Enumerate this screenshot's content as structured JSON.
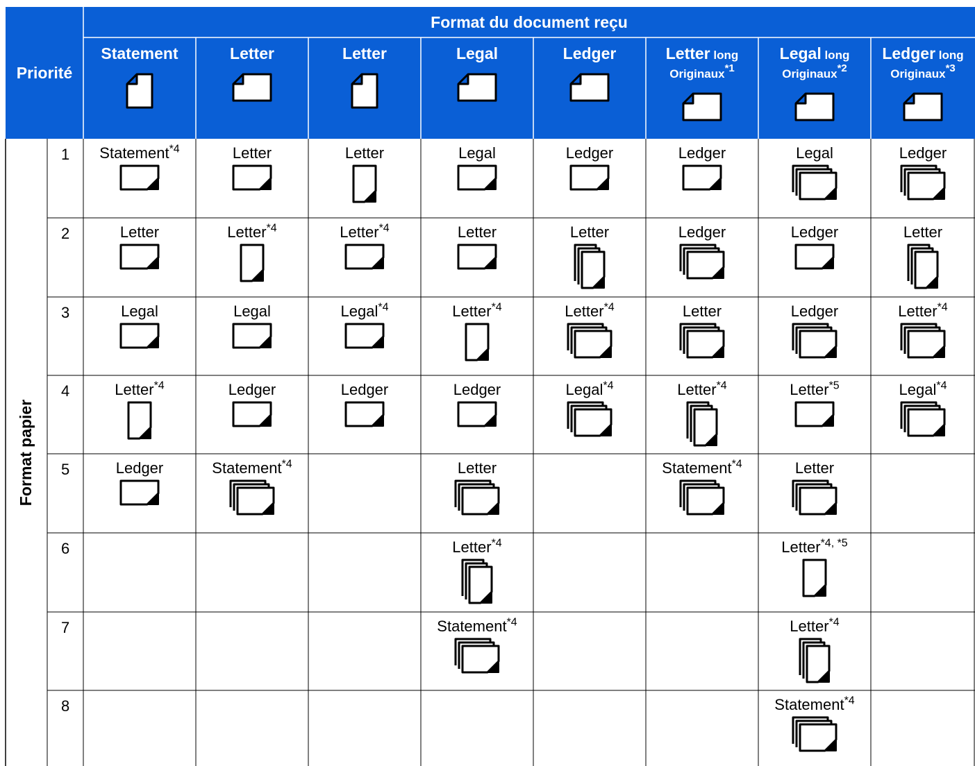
{
  "header": {
    "title": "Format du document reçu",
    "priority_label": "Priorité",
    "side_label": "Format papier"
  },
  "columns": [
    {
      "name": "Statement",
      "suffix": "",
      "line2": "",
      "note": "",
      "icon": "portrait-sheet-folded-top-left"
    },
    {
      "name": "Letter",
      "suffix": "",
      "line2": "",
      "note": "",
      "icon": "landscape-sheet-folded-top-left"
    },
    {
      "name": "Letter",
      "suffix": "",
      "line2": "",
      "note": "",
      "icon": "portrait-sheet-folded-top-left"
    },
    {
      "name": "Legal",
      "suffix": "",
      "line2": "",
      "note": "",
      "icon": "landscape-sheet-folded-top-left"
    },
    {
      "name": "Ledger",
      "suffix": "",
      "line2": "",
      "note": "",
      "icon": "landscape-sheet-folded-top-left"
    },
    {
      "name": "Letter",
      "suffix": " long",
      "line2": "Originaux",
      "note": "*1",
      "icon": "landscape-sheet-folded-top-left"
    },
    {
      "name": "Legal",
      "suffix": " long",
      "line2": "Originaux",
      "note": "*2",
      "icon": "landscape-sheet-folded-top-left"
    },
    {
      "name": "Ledger",
      "suffix": " long",
      "line2": "Originaux",
      "note": "*3",
      "icon": "landscape-sheet-folded-top-left"
    }
  ],
  "rows": [
    {
      "num": "1",
      "cells": [
        {
          "label": "Statement",
          "note": "*4",
          "icon": "landscape"
        },
        {
          "label": "Letter",
          "note": "",
          "icon": "landscape"
        },
        {
          "label": "Letter",
          "note": "",
          "icon": "portrait"
        },
        {
          "label": "Legal",
          "note": "",
          "icon": "landscape"
        },
        {
          "label": "Ledger",
          "note": "",
          "icon": "landscape"
        },
        {
          "label": "Ledger",
          "note": "",
          "icon": "landscape"
        },
        {
          "label": "Legal",
          "note": "",
          "icon": "landscape-multi"
        },
        {
          "label": "Ledger",
          "note": "",
          "icon": "landscape-multi"
        }
      ]
    },
    {
      "num": "2",
      "cells": [
        {
          "label": "Letter",
          "note": "",
          "icon": "landscape"
        },
        {
          "label": "Letter",
          "note": "*4",
          "icon": "portrait"
        },
        {
          "label": "Letter",
          "note": "*4",
          "icon": "landscape"
        },
        {
          "label": "Letter",
          "note": "",
          "icon": "landscape"
        },
        {
          "label": "Letter",
          "note": "",
          "icon": "portrait-multi"
        },
        {
          "label": "Ledger",
          "note": "",
          "icon": "landscape-multi"
        },
        {
          "label": "Ledger",
          "note": "",
          "icon": "landscape"
        },
        {
          "label": "Letter",
          "note": "",
          "icon": "portrait-multi"
        }
      ]
    },
    {
      "num": "3",
      "cells": [
        {
          "label": "Legal",
          "note": "",
          "icon": "landscape"
        },
        {
          "label": "Legal",
          "note": "",
          "icon": "landscape"
        },
        {
          "label": "Legal",
          "note": "*4",
          "icon": "landscape"
        },
        {
          "label": "Letter",
          "note": "*4",
          "icon": "portrait"
        },
        {
          "label": "Letter",
          "note": "*4",
          "icon": "landscape-multi"
        },
        {
          "label": "Letter",
          "note": "",
          "icon": "landscape-multi"
        },
        {
          "label": "Ledger",
          "note": "",
          "icon": "landscape-multi"
        },
        {
          "label": "Letter",
          "note": "*4",
          "icon": "landscape-multi"
        }
      ]
    },
    {
      "num": "4",
      "cells": [
        {
          "label": "Letter",
          "note": "*4",
          "icon": "portrait"
        },
        {
          "label": "Ledger",
          "note": "",
          "icon": "landscape"
        },
        {
          "label": "Ledger",
          "note": "",
          "icon": "landscape"
        },
        {
          "label": "Ledger",
          "note": "",
          "icon": "landscape"
        },
        {
          "label": "Legal",
          "note": "*4",
          "icon": "landscape-multi"
        },
        {
          "label": "Letter",
          "note": "*4",
          "icon": "portrait-multi"
        },
        {
          "label": "Letter",
          "note": "*5",
          "icon": "landscape"
        },
        {
          "label": "Legal",
          "note": "*4",
          "icon": "landscape-multi"
        }
      ]
    },
    {
      "num": "5",
      "cells": [
        {
          "label": "Ledger",
          "note": "",
          "icon": "landscape"
        },
        {
          "label": "Statement",
          "note": "*4",
          "icon": "landscape-multi"
        },
        {
          "label": "",
          "note": "",
          "icon": ""
        },
        {
          "label": "Letter",
          "note": "",
          "icon": "landscape-multi"
        },
        {
          "label": "",
          "note": "",
          "icon": ""
        },
        {
          "label": "Statement",
          "note": "*4",
          "icon": "landscape-multi"
        },
        {
          "label": "Letter",
          "note": "",
          "icon": "landscape-multi"
        },
        {
          "label": "",
          "note": "",
          "icon": ""
        }
      ]
    },
    {
      "num": "6",
      "cells": [
        {
          "label": "",
          "note": "",
          "icon": ""
        },
        {
          "label": "",
          "note": "",
          "icon": ""
        },
        {
          "label": "",
          "note": "",
          "icon": ""
        },
        {
          "label": "Letter",
          "note": "*4",
          "icon": "portrait-multi"
        },
        {
          "label": "",
          "note": "",
          "icon": ""
        },
        {
          "label": "",
          "note": "",
          "icon": ""
        },
        {
          "label": "Letter",
          "note": "*4, *5",
          "icon": "portrait"
        },
        {
          "label": "",
          "note": "",
          "icon": ""
        }
      ]
    },
    {
      "num": "7",
      "cells": [
        {
          "label": "",
          "note": "",
          "icon": ""
        },
        {
          "label": "",
          "note": "",
          "icon": ""
        },
        {
          "label": "",
          "note": "",
          "icon": ""
        },
        {
          "label": "Statement",
          "note": "*4",
          "icon": "landscape-multi"
        },
        {
          "label": "",
          "note": "",
          "icon": ""
        },
        {
          "label": "",
          "note": "",
          "icon": ""
        },
        {
          "label": "Letter",
          "note": "*4",
          "icon": "portrait-multi"
        },
        {
          "label": "",
          "note": "",
          "icon": ""
        }
      ]
    },
    {
      "num": "8",
      "cells": [
        {
          "label": "",
          "note": "",
          "icon": ""
        },
        {
          "label": "",
          "note": "",
          "icon": ""
        },
        {
          "label": "",
          "note": "",
          "icon": ""
        },
        {
          "label": "",
          "note": "",
          "icon": ""
        },
        {
          "label": "",
          "note": "",
          "icon": ""
        },
        {
          "label": "",
          "note": "",
          "icon": ""
        },
        {
          "label": "Statement",
          "note": "*4",
          "icon": "landscape-multi"
        },
        {
          "label": "",
          "note": "",
          "icon": ""
        }
      ]
    }
  ],
  "colors": {
    "header_bg": "#0a5fd6",
    "header_text": "#ffffff",
    "grid_line": "#000000"
  }
}
